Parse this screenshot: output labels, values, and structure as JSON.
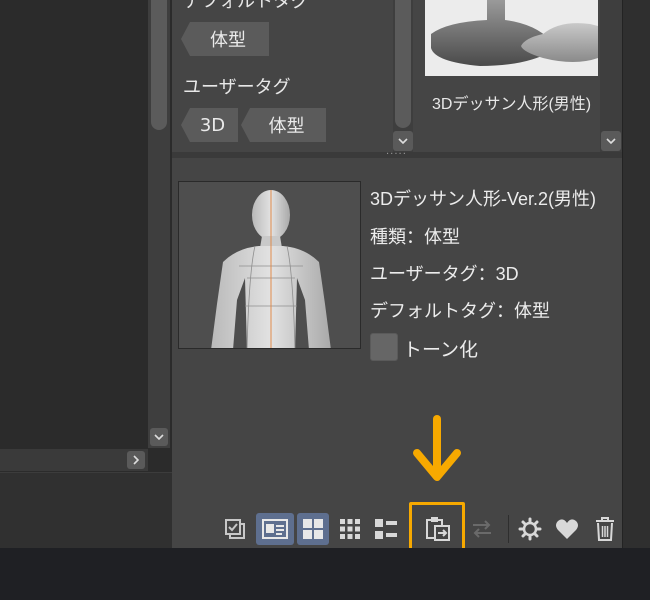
{
  "tags": {
    "default_tag_heading": "デフォルトタグ",
    "default_tags": [
      "体型"
    ],
    "user_tag_heading": "ユーザータグ",
    "user_tags": [
      "3D",
      "体型"
    ]
  },
  "material": {
    "thumbnail_label": "3Dデッサン人形(男性)"
  },
  "detail": {
    "name": "3Dデッサン人形-Ver.2(男性)",
    "type_line": "種類：体型",
    "user_tag_line": "ユーザータグ：3D",
    "default_tag_line": "デフォルトタグ：体型",
    "tone_checkbox_label": "トーン化",
    "tone_checked": false
  },
  "toolbar": {
    "buttons": [
      {
        "name": "select-all-icon",
        "active": false
      },
      {
        "name": "detail-view-icon",
        "active": true
      },
      {
        "name": "large-thumbnail-icon",
        "active": true
      },
      {
        "name": "small-thumbnail-icon",
        "active": false
      },
      {
        "name": "list-view-icon",
        "active": false
      },
      {
        "name": "paste-to-canvas-icon",
        "active": false,
        "highlighted": true
      },
      {
        "name": "replace-icon",
        "active": false,
        "disabled": true
      },
      {
        "name": "settings-gear-icon",
        "active": false
      },
      {
        "name": "favorite-heart-icon",
        "active": false
      },
      {
        "name": "trash-icon",
        "active": false
      }
    ]
  },
  "colors": {
    "highlight": "#f7a900",
    "panel_bg": "#454545",
    "active_button": "#5e6f8f"
  }
}
